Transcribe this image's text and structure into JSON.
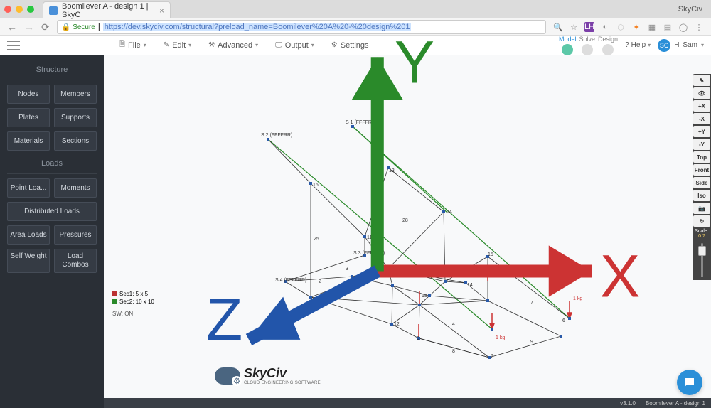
{
  "browser": {
    "window_title": "SkyCiv",
    "tab_title": "Boomilever A - design 1 | SkyC",
    "secure_label": "Secure",
    "url": "https://dev.skyciv.com/structural?preload_name=Boomilever%20A%20-%20design%201"
  },
  "menubar": {
    "file": "File",
    "edit": "Edit",
    "advanced": "Advanced",
    "output": "Output",
    "settings": "Settings",
    "model": "Model",
    "solve": "Solve",
    "design": "Design",
    "help": "Help",
    "user_initials": "SC",
    "user_greeting": "Hi Sam"
  },
  "sidebar": {
    "structure_header": "Structure",
    "loads_header": "Loads",
    "nodes": "Nodes",
    "members": "Members",
    "plates": "Plates",
    "supports": "Supports",
    "materials": "Materials",
    "sections": "Sections",
    "point_loads": "Point Loa...",
    "moments": "Moments",
    "distributed_loads": "Distributed Loads",
    "area_loads": "Area Loads",
    "pressures": "Pressures",
    "self_weight": "Self Weight",
    "load_combos": "Load Combos"
  },
  "legend": {
    "sec1": "Sec1: 5 x 5",
    "sec2": "Sec2: 10 x 10",
    "sw": "SW: ON"
  },
  "axes": {
    "x": "X",
    "y": "Y",
    "z": "Z"
  },
  "model_labels": {
    "s1": "S 1 (FFFFRR)",
    "s2": "S 2 (FFFFRR)",
    "s3": "S 3 (FFFFRR)",
    "s4": "S 4 (FFFFRR)",
    "load1": "1 kg",
    "load2": "1 kg"
  },
  "right_toolbar": {
    "buttons": [
      "✎",
      "👁",
      "+X",
      "-X",
      "+Y",
      "-Y",
      "Top",
      "Front",
      "Side",
      "Iso",
      "📷",
      "↻"
    ],
    "scale_label": "Scale:",
    "scale_value": "0.7"
  },
  "logo": {
    "name": "SkyCiv",
    "tagline": "CLOUD ENGINEERING SOFTWARE"
  },
  "footer": {
    "version": "v3.1.0",
    "project": "Boomilever A - design 1"
  }
}
